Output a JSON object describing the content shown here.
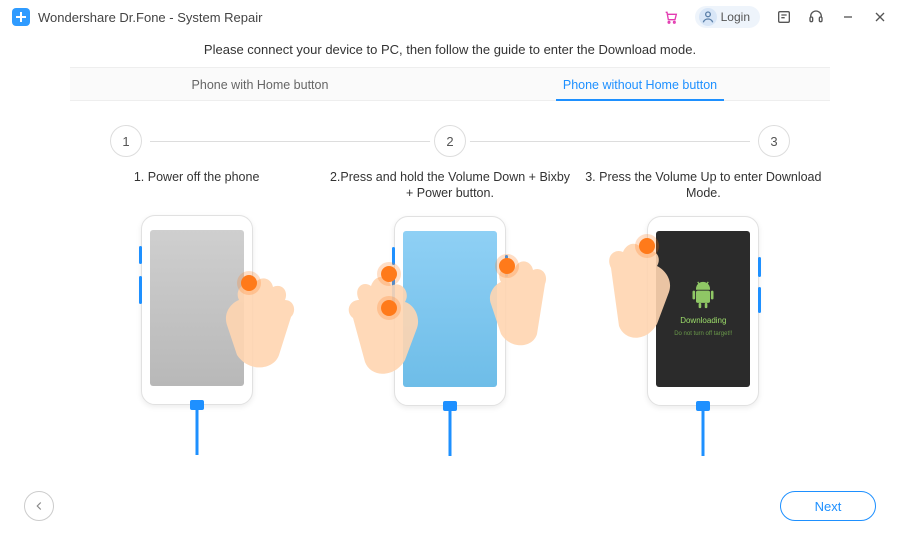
{
  "titlebar": {
    "app_title": "Wondershare Dr.Fone - System Repair",
    "login_label": "Login"
  },
  "instruction": "Please connect your device to PC, then follow the guide to enter the Download mode.",
  "tabs": {
    "with_home": "Phone with Home button",
    "without_home": "Phone without Home button"
  },
  "step_numbers": {
    "one": "1",
    "two": "2",
    "three": "3"
  },
  "steps": {
    "s1": "1. Power off the phone",
    "s2": "2.Press and hold the Volume Down + Bixby + Power button.",
    "s3": "3. Press the Volume Up to enter Download Mode."
  },
  "download_screen": {
    "title": "Downloading",
    "subtitle": "Do not turn off target!!"
  },
  "footer": {
    "next_label": "Next"
  }
}
